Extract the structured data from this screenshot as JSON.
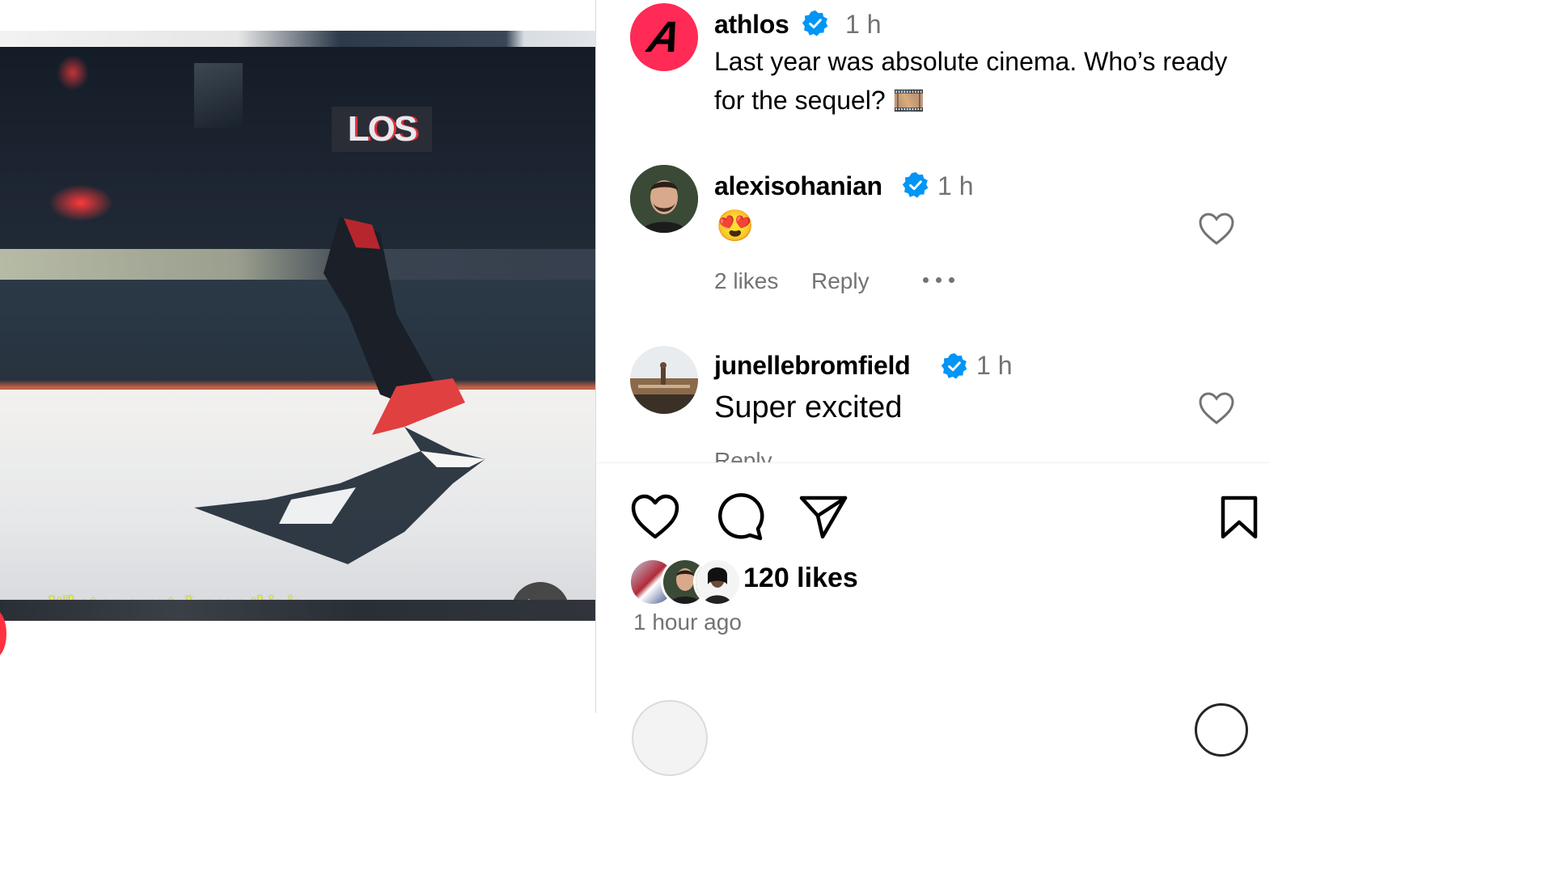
{
  "post": {
    "author": "athlos",
    "time": "1 h",
    "caption": "Last year was absolute cinema. Who’s ready for the sequel? 🎞️",
    "avatar_letter": "A",
    "avatar_color": "#ff2a55"
  },
  "video": {
    "subtitle": "What an event. I mean this is...",
    "sign_text": "LOS",
    "mute_icon": "speaker-muted-icon"
  },
  "comments": [
    {
      "user": "alexisohanian",
      "time": "1 h",
      "text": "😍",
      "likes": "2 likes",
      "reply": "Reply"
    },
    {
      "user": "junellebromfield",
      "time": "1 h",
      "text": "Super excited",
      "reply": "Reply"
    }
  ],
  "actions": {
    "like_icon": "heart-icon",
    "comment_icon": "comment-icon",
    "share_icon": "paper-plane-icon",
    "save_icon": "bookmark-icon"
  },
  "likes": "120 likes",
  "posted": "1 hour ago",
  "colors": {
    "verified": "#0095f6",
    "secondary_text": "#737373",
    "border": "#dbdbdb"
  }
}
